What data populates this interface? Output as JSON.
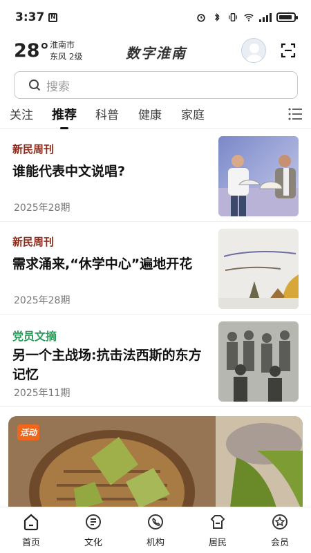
{
  "status_bar": {
    "time": "3:37"
  },
  "header": {
    "temperature": "28°",
    "city": "淮南市",
    "wind": "东风  2级",
    "logo": "数字淮南"
  },
  "search": {
    "placeholder": "搜索"
  },
  "tabs": [
    {
      "label": "关注",
      "active": false
    },
    {
      "label": "推荐",
      "active": true
    },
    {
      "label": "科普",
      "active": false
    },
    {
      "label": "健康",
      "active": false
    },
    {
      "label": "家庭",
      "active": false
    }
  ],
  "articles": [
    {
      "source": "新民周刊",
      "title": "谁能代表中文说唱?",
      "date": "2025年28期"
    },
    {
      "source": "新民周刊",
      "title": "需求涌来,“休学中心”遍地开花",
      "date": "2025年28期"
    },
    {
      "source": "党员文摘",
      "title": "另一个主战场:抗击法西斯的东方记忆",
      "date": "2025年11期"
    }
  ],
  "banner": {
    "badge": "活动"
  },
  "bottom_nav": [
    {
      "label": "首页",
      "icon": "home-icon"
    },
    {
      "label": "文化",
      "icon": "culture-icon"
    },
    {
      "label": "机构",
      "icon": "institution-icon"
    },
    {
      "label": "居民",
      "icon": "resident-icon"
    },
    {
      "label": "会员",
      "icon": "member-icon"
    }
  ]
}
